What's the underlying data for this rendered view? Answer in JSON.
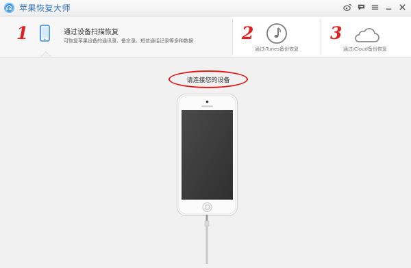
{
  "app": {
    "title": "苹果恢复大师"
  },
  "steps": [
    {
      "number": "1",
      "title": "通过设备扫描恢复",
      "desc": "可恢复苹果设备的通讯录、备忘录、短信通话记录等多种数据",
      "icon": "smartphone-icon",
      "active": true
    },
    {
      "number": "2",
      "label": "通过iTunes备份恢复",
      "icon": "music-note-icon"
    },
    {
      "number": "3",
      "label": "通过iCloud备份恢复",
      "icon": "cloud-icon"
    }
  ],
  "main": {
    "prompt": "请连接您的设备"
  },
  "window_controls": [
    "weibo-icon",
    "chat-icon",
    "menu-icon",
    "minimize-icon",
    "close-icon"
  ],
  "colors": {
    "accent": "#2b6fb5",
    "annotation": "#e01818"
  }
}
